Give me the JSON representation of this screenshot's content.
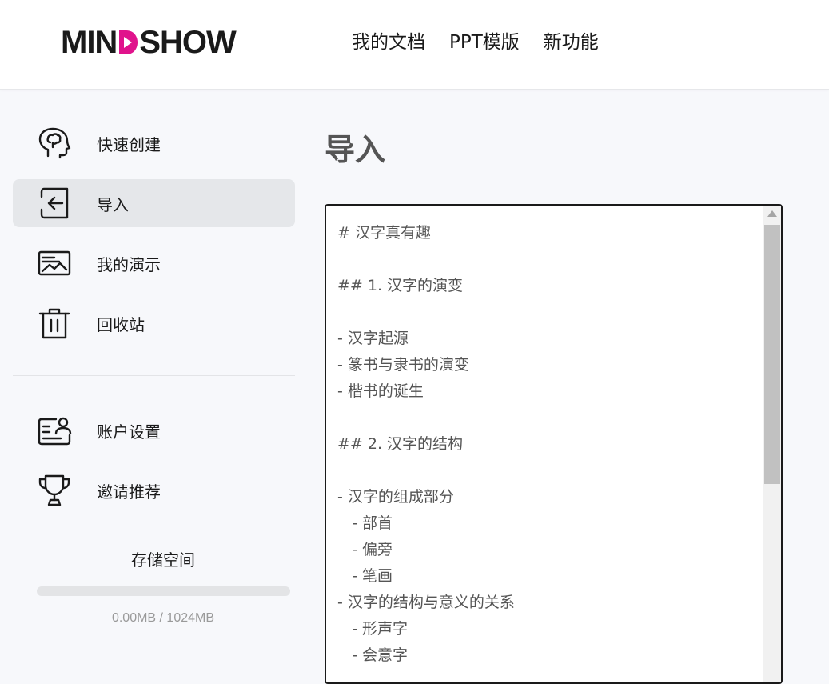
{
  "brand": {
    "logo_text_left": "MIN",
    "logo_text_right": "SHOW",
    "accent_color": "#e0138c"
  },
  "nav": {
    "items": [
      {
        "label": "我的文档"
      },
      {
        "label": "PPT模版"
      },
      {
        "label": "新功能"
      }
    ]
  },
  "sidebar": {
    "items": [
      {
        "label": "快速创建",
        "icon": "brain-head-icon"
      },
      {
        "label": "导入",
        "icon": "import-icon",
        "active": true
      },
      {
        "label": "我的演示",
        "icon": "presentation-icon"
      },
      {
        "label": "回收站",
        "icon": "trash-icon"
      },
      {
        "label": "账户设置",
        "icon": "account-card-icon"
      },
      {
        "label": "邀请推荐",
        "icon": "trophy-icon"
      }
    ],
    "storage": {
      "title": "存储空间",
      "used_text": "0.00MB / 1024MB",
      "used_fraction": 0.0
    }
  },
  "main": {
    "title": "导入",
    "editor": {
      "lines": [
        "# 汉字真有趣",
        "",
        "## 1. 汉字的演变",
        "",
        "- 汉字起源",
        "- 篆书与隶书的演变",
        "- 楷书的诞生",
        "",
        "## 2. 汉字的结构",
        "",
        "- 汉字的组成部分",
        "   - 部首",
        "   - 偏旁",
        "   - 笔画",
        "- 汉字的结构与意义的关系",
        "   - 形声字",
        "   - 会意字"
      ]
    }
  }
}
